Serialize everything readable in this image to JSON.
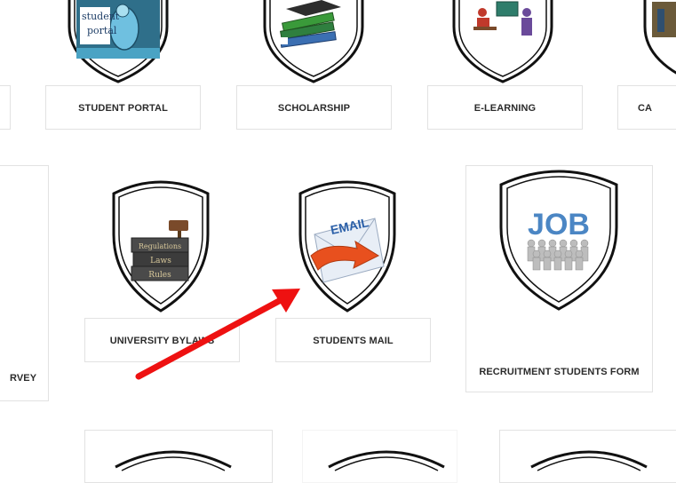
{
  "row1": [
    {
      "label": "STUDENT PORTAL"
    },
    {
      "label": "SCHOLARSHIP"
    },
    {
      "label": "E-LEARNING"
    },
    {
      "label": "CA"
    }
  ],
  "row2": [
    {
      "label": "RVEY"
    },
    {
      "label": "UNIVERSITY BYLAWS"
    },
    {
      "label": "STUDENTS MAIL"
    },
    {
      "label": "RECRUITMENT STUDENTS FORM"
    }
  ],
  "icons": {
    "portal_line1": "student",
    "portal_line2": "portal",
    "email_text": "EMAIL",
    "job_text": "JOB",
    "bylaw_book1": "Regulations",
    "bylaw_book2": "Laws",
    "bylaw_book3": "Rules"
  },
  "colors": {
    "label_text": "#2b2b2b",
    "card_border": "#e2e2e2",
    "annotation_arrow": "#ee1111"
  }
}
